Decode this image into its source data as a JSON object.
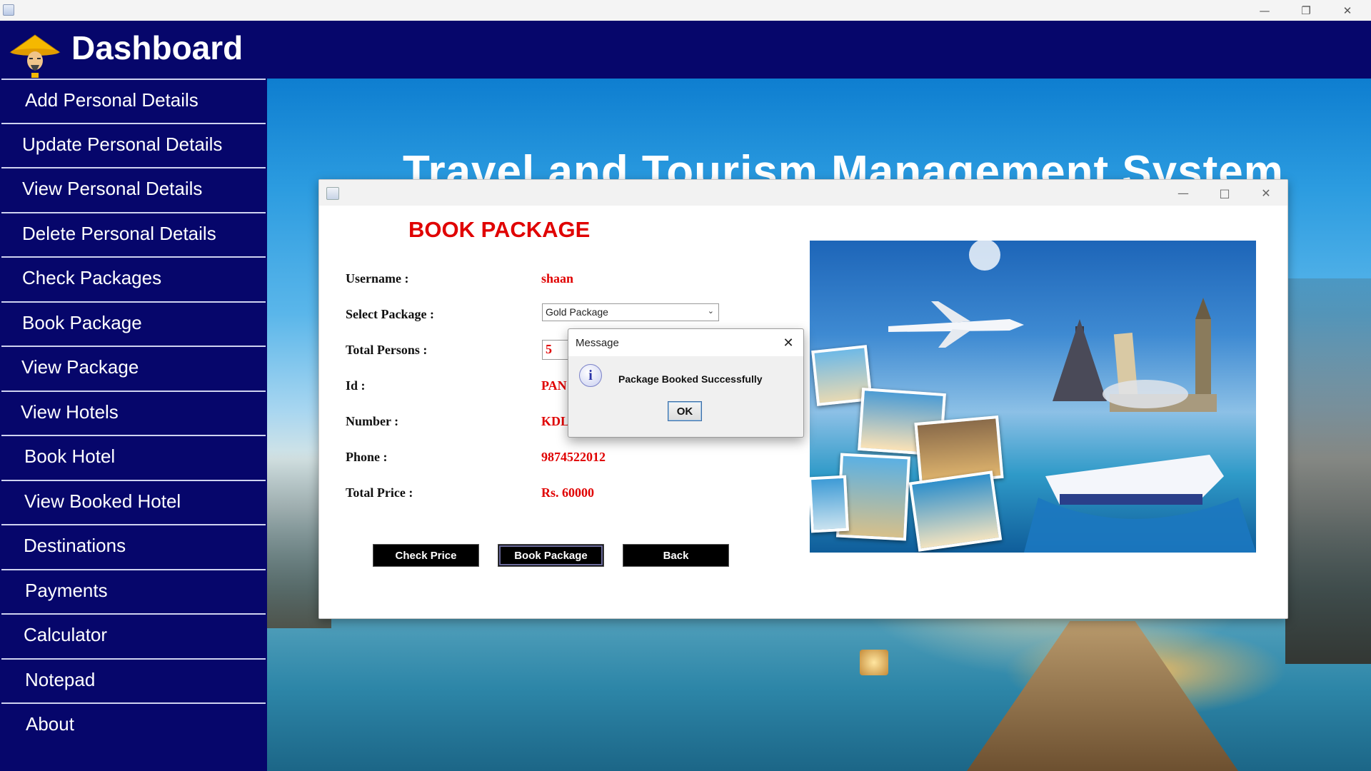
{
  "os_window": {
    "minimize_icon": "minimize-icon",
    "maximize_icon": "restore-icon",
    "close_icon": "close-icon"
  },
  "header": {
    "title": "Dashboard",
    "logo_icon": "man-with-straw-hat-icon"
  },
  "sidebar": {
    "items": [
      {
        "label": "Add Personal Details"
      },
      {
        "label": "Update Personal Details"
      },
      {
        "label": "View Personal Details"
      },
      {
        "label": "Delete Personal Details"
      },
      {
        "label": "Check Packages"
      },
      {
        "label": "Book Package"
      },
      {
        "label": "View Package"
      },
      {
        "label": "View Hotels"
      },
      {
        "label": "Book Hotel"
      },
      {
        "label": "View Booked Hotel"
      },
      {
        "label": "Destinations"
      },
      {
        "label": "Payments"
      },
      {
        "label": "Calculator"
      },
      {
        "label": "Notepad"
      },
      {
        "label": "About"
      }
    ]
  },
  "background": {
    "title": "Travel and Tourism Management System"
  },
  "book_package_window": {
    "heading": "BOOK PACKAGE",
    "fields": {
      "username": {
        "label": "Username :",
        "value": "shaan"
      },
      "package": {
        "label": "Select Package :",
        "value": "Gold Package"
      },
      "persons": {
        "label": "Total Persons :",
        "value": "5"
      },
      "id": {
        "label": "Id :",
        "value": "PAN"
      },
      "number": {
        "label": "Number :",
        "value": "KDL"
      },
      "phone": {
        "label": "Phone :",
        "value": "9874522012"
      },
      "price": {
        "label": "Total Price :",
        "value": "Rs. 60000"
      }
    },
    "buttons": {
      "check_price": "Check Price",
      "book_package": "Book Package",
      "back": "Back"
    }
  },
  "message_dialog": {
    "title": "Message",
    "message": "Package Booked Successfully",
    "ok": "OK",
    "icon": "information-icon"
  },
  "colors": {
    "sidebar_bg": "#06066b",
    "accent_red": "#e00000"
  }
}
